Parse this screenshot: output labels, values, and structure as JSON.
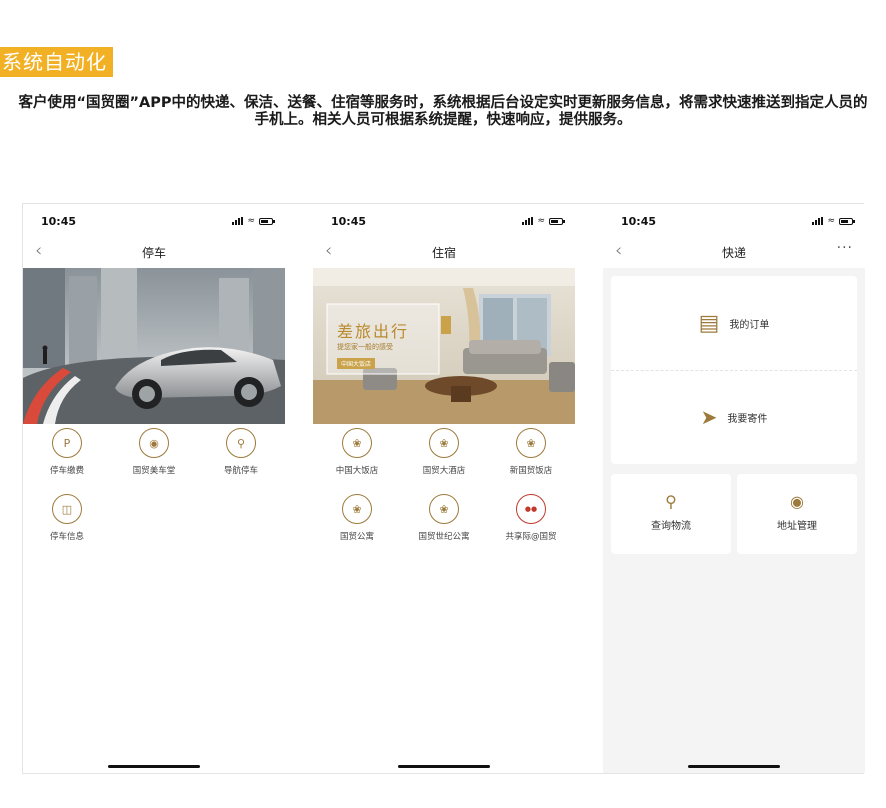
{
  "heading": "系统自动化",
  "intro": "客户使用“国贸圈”APP中的快递、保洁、送餐、住宿等服务时，系统根据后台设定实时更新服务信息，将需求快速推送到指定人员的手机上。相关人员可根据系统提醒，快速响应，提供服务。",
  "accent_color": "#f2b024",
  "icon_color": "#9d7a3c",
  "screens": {
    "parking": {
      "time": "10:45",
      "title": "停车",
      "items": [
        {
          "label": "停车缴费",
          "icon": "parking-pay-icon"
        },
        {
          "label": "国贸美车堂",
          "icon": "car-care-icon"
        },
        {
          "label": "导航停车",
          "icon": "car-search-icon"
        },
        {
          "label": "停车信息",
          "icon": "car-info-icon"
        }
      ]
    },
    "lodging": {
      "time": "10:45",
      "title": "住宿",
      "banner": {
        "headline": "差旅出行",
        "tagline": "提您家一般的感受",
        "button": "中国大饭店"
      },
      "items": [
        {
          "label": "中国大饭店",
          "icon": "hotel-logo-icon"
        },
        {
          "label": "国贸大酒店",
          "icon": "hotel-logo-icon"
        },
        {
          "label": "新国贸饭店",
          "icon": "hotel-logo-icon"
        },
        {
          "label": "国贸公寓",
          "icon": "hotel-logo-icon"
        },
        {
          "label": "国贸世纪公寓",
          "icon": "hotel-logo-icon"
        },
        {
          "label": "共享际@国贸",
          "icon": "brand-logo-icon"
        }
      ]
    },
    "express": {
      "time": "10:45",
      "title": "快递",
      "more": "···",
      "my_orders": "我的订单",
      "send_parcel": "我要寄件",
      "track": "查询物流",
      "address": "地址管理"
    }
  }
}
